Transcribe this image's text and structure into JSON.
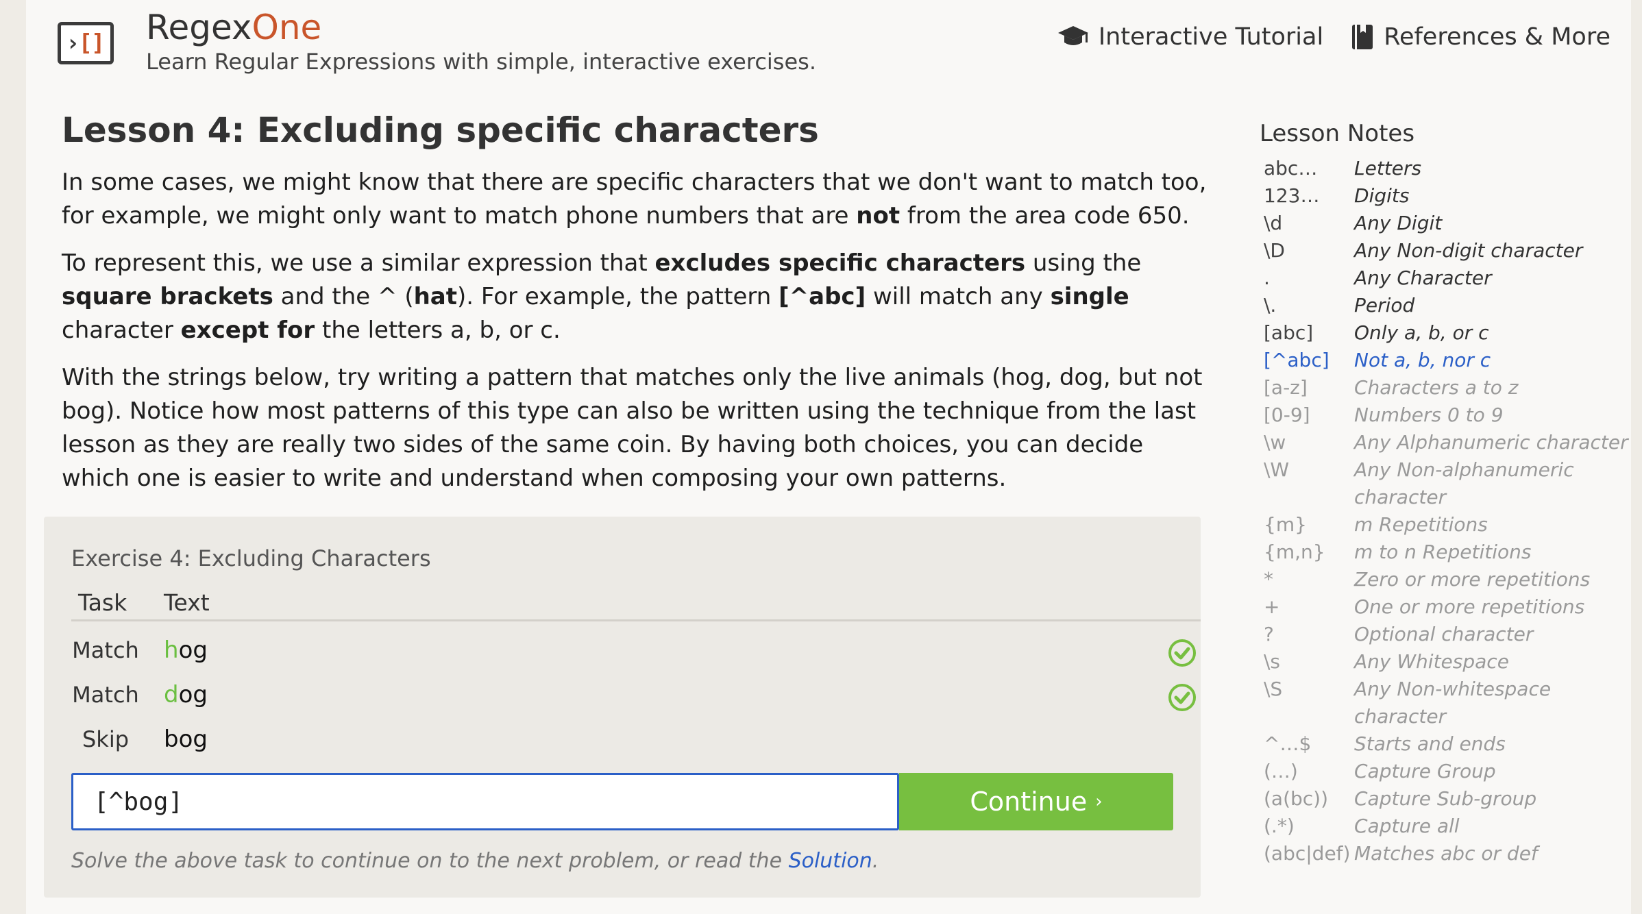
{
  "header": {
    "brand_main": "Regex",
    "brand_accent": "One",
    "tagline": "Learn Regular Expressions with simple, interactive exercises.",
    "nav": [
      {
        "label": "Interactive Tutorial",
        "icon": "graduation-cap-icon"
      },
      {
        "label": "References & More",
        "icon": "book-icon"
      }
    ]
  },
  "lesson": {
    "title": "Lesson 4: Excluding specific characters",
    "p1": {
      "a": "In some cases, we might know that there are specific characters that we don't want to match too, for example, we might only want to match phone numbers that are ",
      "b": "not",
      "c": " from the area code 650."
    },
    "p2": {
      "a": "To represent this, we use a similar expression that ",
      "b": "excludes specific characters",
      "c": " using the ",
      "d": "square brackets",
      "e": " and the ^ (",
      "f": "hat",
      "g": "). For example, the pattern ",
      "h": "[^abc]",
      "i": " will match any ",
      "j": "single",
      "k": " character ",
      "l": "except for",
      "m": " the letters a, b, or c."
    },
    "p3": "With the strings below, try writing a pattern that matches only the live animals (hog, dog, but not bog). Notice how most patterns of this type can also be written using the technique from the last lesson as they are really two sides of the same coin. By having both choices, you can decide which one is easier to write and understand when composing your own patterns."
  },
  "exercise": {
    "title": "Exercise 4: Excluding Characters",
    "col_task": "Task",
    "col_text": "Text",
    "rows": [
      {
        "task": "Match",
        "hl": "h",
        "rest": "og",
        "status": "check-icon"
      },
      {
        "task": "Match",
        "hl": "d",
        "rest": "og",
        "status": "check-icon"
      },
      {
        "task": "Skip",
        "hl": "",
        "rest": "bog",
        "status": ""
      }
    ],
    "input_value": "[^bog]",
    "continue_label": "Continue",
    "continue_chevron": "›",
    "note_prefix": "Solve the above task to continue on to the next problem, or read the ",
    "note_link": "Solution",
    "note_suffix": ".",
    "colors": {
      "accent": "#77bf40",
      "focus": "#2b5fc7"
    }
  },
  "notes": {
    "title": "Lesson Notes",
    "items": [
      {
        "sym": "abc…",
        "desc": "Letters",
        "state": "done"
      },
      {
        "sym": "123…",
        "desc": "Digits",
        "state": "done"
      },
      {
        "sym": "\\d",
        "desc": "Any Digit",
        "state": "done"
      },
      {
        "sym": "\\D",
        "desc": "Any Non-digit character",
        "state": "done"
      },
      {
        "sym": ".",
        "desc": "Any Character",
        "state": "done"
      },
      {
        "sym": "\\.",
        "desc": "Period",
        "state": "done"
      },
      {
        "sym": "[abc]",
        "desc": "Only a, b, or c",
        "state": "done"
      },
      {
        "sym": "[^abc]",
        "desc": "Not a, b, nor c",
        "state": "current"
      },
      {
        "sym": "[a-z]",
        "desc": "Characters a to z",
        "state": "future"
      },
      {
        "sym": "[0-9]",
        "desc": "Numbers 0 to 9",
        "state": "future"
      },
      {
        "sym": "\\w",
        "desc": "Any Alphanumeric character",
        "state": "future"
      },
      {
        "sym": "\\W",
        "desc": "Any Non-alphanumeric character",
        "state": "future"
      },
      {
        "sym": "{m}",
        "desc": "m Repetitions",
        "state": "future"
      },
      {
        "sym": "{m,n}",
        "desc": "m to n Repetitions",
        "state": "future"
      },
      {
        "sym": "*",
        "desc": "Zero or more repetitions",
        "state": "future"
      },
      {
        "sym": "+",
        "desc": "One or more repetitions",
        "state": "future"
      },
      {
        "sym": "?",
        "desc": "Optional character",
        "state": "future"
      },
      {
        "sym": "\\s",
        "desc": "Any Whitespace",
        "state": "future"
      },
      {
        "sym": "\\S",
        "desc": "Any Non-whitespace character",
        "state": "future"
      },
      {
        "sym": "^…$",
        "desc": "Starts and ends",
        "state": "future"
      },
      {
        "sym": "(…)",
        "desc": "Capture Group",
        "state": "future"
      },
      {
        "sym": "(a(bc))",
        "desc": "Capture Sub-group",
        "state": "future"
      },
      {
        "sym": "(.*)",
        "desc": "Capture all",
        "state": "future"
      },
      {
        "sym": "(abc|def)",
        "desc": "Matches abc or def",
        "state": "future"
      }
    ]
  }
}
